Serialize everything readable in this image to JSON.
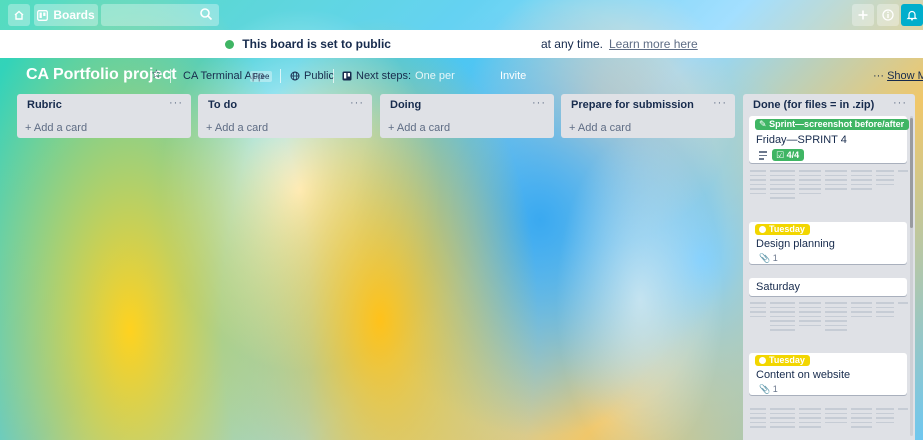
{
  "topbar": {
    "home_icon": "home-icon",
    "boards_label": "Boards",
    "search_icon": "search-icon",
    "plus_icon": "plus-icon",
    "info_icon": "info-icon",
    "bell_icon": "bell-icon"
  },
  "banner": {
    "text_start": "This board is set to public",
    "text_end": "at any time.",
    "link": "Learn more here"
  },
  "board": {
    "title": "CA Portfolio project",
    "team": "CA Terminal App",
    "team_badge": "Free",
    "visibility": "Public",
    "next_steps_label": "Next steps:",
    "next_steps_value": "One per",
    "invite": "Invite",
    "show_menu": "Show Me"
  },
  "lists": [
    {
      "title": "Rubric",
      "add_card": "+ Add a card"
    },
    {
      "title": "To do",
      "add_card": "+ Add a card"
    },
    {
      "title": "Doing",
      "add_card": "+ Add a card"
    },
    {
      "title": "Prepare for submission",
      "add_card": "+ Add a card"
    }
  ],
  "done_list": {
    "title": "Done (for files = in .zip)",
    "cards": [
      {
        "label": "Sprint—screenshot before/after",
        "title": "Friday—SPRINT 4",
        "checklist": "4/4"
      },
      {
        "label": "Tuesday",
        "title": "Design planning",
        "attachments": "1"
      },
      {
        "title": "Saturday"
      },
      {
        "label": "Tuesday",
        "title": "Content on website",
        "attachments": "1"
      }
    ]
  },
  "colors": {
    "green_label": "#3fb564",
    "yellow_label": "#f2d600",
    "list_bg": "#dfe1e6",
    "bell_bg": "#00aecc"
  }
}
